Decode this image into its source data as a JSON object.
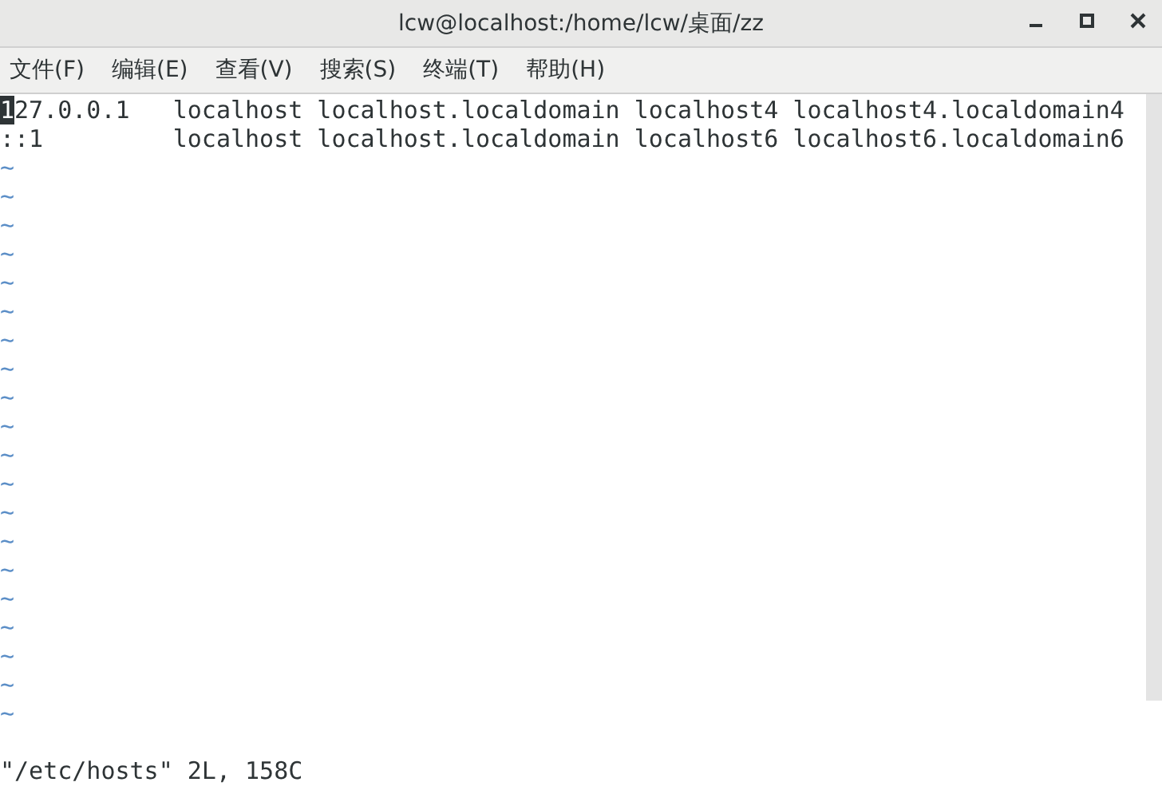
{
  "window": {
    "title": "lcw@localhost:/home/lcw/桌面/zz"
  },
  "menu": [
    "文件(F)",
    "编辑(E)",
    "查看(V)",
    "搜索(S)",
    "终端(T)",
    "帮助(H)"
  ],
  "editor": {
    "lines": [
      {
        "text": "127.0.0.1   localhost localhost.localdomain localhost4 localhost4.localdomain4",
        "cursor": true
      },
      {
        "text": "::1         localhost localhost.localdomain localhost6 localhost6.localdomain6",
        "cursor": false
      }
    ],
    "empty_lines": [
      "~",
      "~",
      "~",
      "~",
      "~",
      "~",
      "~",
      "~",
      "~",
      "~",
      "~",
      "~",
      "~",
      "~",
      "~",
      "~",
      "~",
      "~",
      "~",
      "~"
    ],
    "status_line": "\"/etc/hosts\" 2L, 158C"
  }
}
